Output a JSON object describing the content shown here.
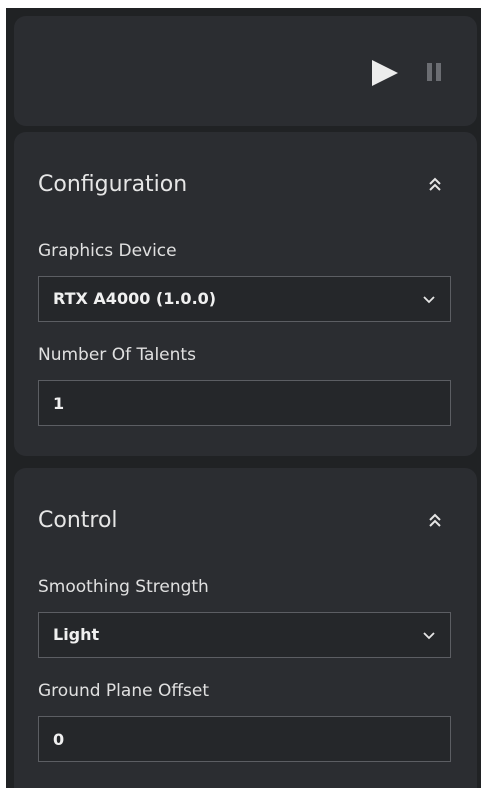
{
  "colors": {
    "window_bg": "#202224",
    "panel_bg": "#2b2d31",
    "field_border": "#5c5e63",
    "text": "#e6e6e6",
    "icon": "#ececec",
    "icon_dim": "#6b6d72"
  },
  "playback": {
    "play_icon": "play-icon",
    "pause_icon": "pause-icon"
  },
  "configuration": {
    "title": "Configuration",
    "collapse_icon": "chevron-double-up-icon",
    "graphics_device": {
      "label": "Graphics Device",
      "value": "RTX A4000 (1.0.0)"
    },
    "talents": {
      "label": "Number Of Talents",
      "value": "1"
    }
  },
  "control": {
    "title": "Control",
    "collapse_icon": "chevron-double-up-icon",
    "smoothing": {
      "label": "Smoothing Strength",
      "value": "Light"
    },
    "ground_offset": {
      "label": "Ground Plane Offset",
      "value": "0"
    }
  }
}
